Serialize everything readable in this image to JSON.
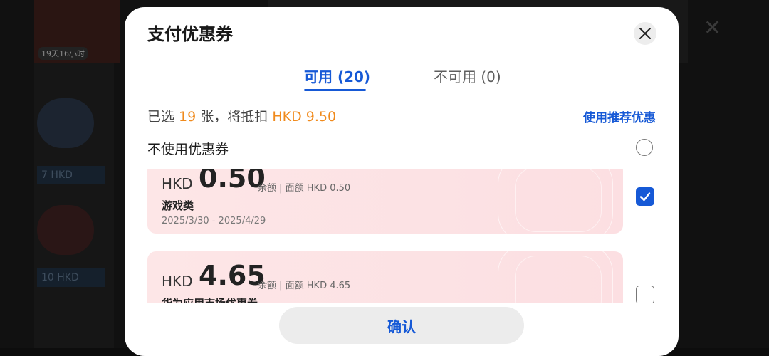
{
  "background": {
    "timer": "19天16小时",
    "price_1": "7 HKD",
    "price_2": "10 HKD"
  },
  "dialog": {
    "title": "支付优惠券",
    "tabs": [
      {
        "label": "可用 (20)",
        "active": true
      },
      {
        "label": "不可用 (0)",
        "active": false
      }
    ],
    "summary": {
      "prefix": "已选 ",
      "count": "19",
      "middle": " 张，将抵扣 ",
      "amount": "HKD 9.50"
    },
    "recommend_label": "使用推荐优惠",
    "no_coupon_label": "不使用优惠券",
    "coupons": [
      {
        "currency": "HKD",
        "amount": "0.50",
        "balance": "余额 | 面额 HKD 0.50",
        "category": "游戏类",
        "dates": "2025/3/30 - 2025/4/29",
        "checked": true
      },
      {
        "currency": "HKD",
        "amount": "4.65",
        "balance": "余额 | 面额 HKD 4.65",
        "category": "华为应用市场优惠券",
        "dates": "",
        "checked": false
      }
    ],
    "confirm_label": "确认"
  },
  "colors": {
    "accent": "#1659d6",
    "highlight": "#f08a1c",
    "card_bg": "#fde6e7"
  }
}
